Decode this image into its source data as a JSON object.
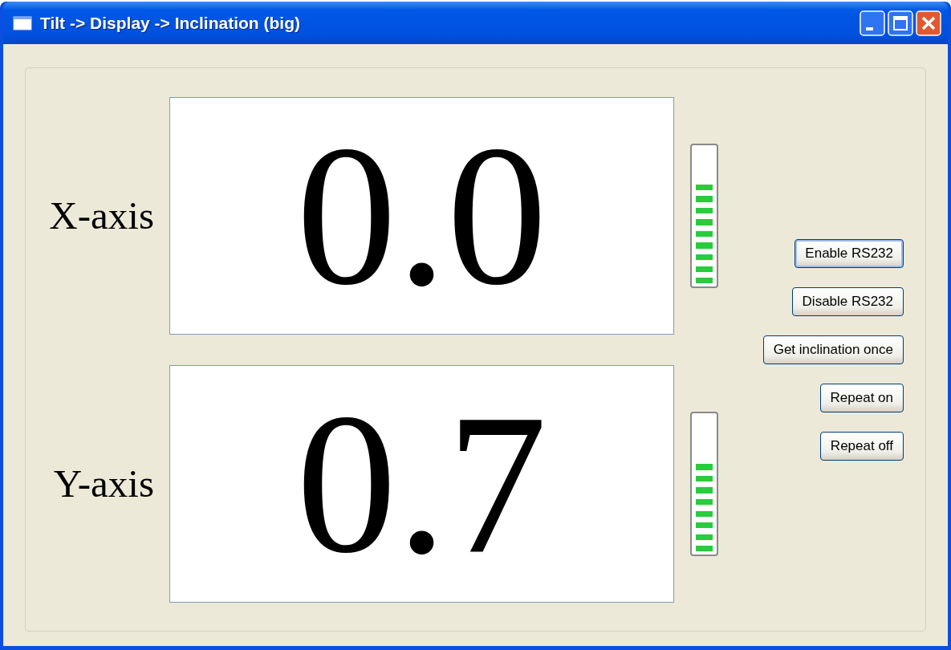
{
  "window": {
    "title": "Tilt -> Display -> Inclination (big)"
  },
  "axes": [
    {
      "label": "X-axis",
      "value": "0.0",
      "level": 0.75
    },
    {
      "label": "Y-axis",
      "value": "0.7",
      "level": 0.67
    }
  ],
  "buttons": [
    {
      "label": "Enable RS232",
      "focused": true
    },
    {
      "label": "Disable RS232",
      "focused": false
    },
    {
      "label": "Get inclination once",
      "focused": false
    },
    {
      "label": "Repeat on",
      "focused": false
    },
    {
      "label": "Repeat off",
      "focused": false
    }
  ]
}
